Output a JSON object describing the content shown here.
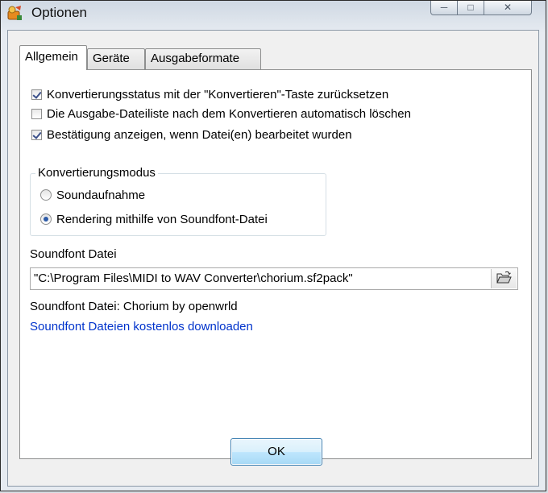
{
  "window": {
    "title": "Optionen",
    "buttons": {
      "minimize": "minimize",
      "maximize": "maximize",
      "close": "close"
    }
  },
  "tabs": [
    {
      "label": "Allgemein",
      "active": true
    },
    {
      "label": "Geräte",
      "active": false
    },
    {
      "label": "Ausgabeformate",
      "active": false
    }
  ],
  "options": [
    {
      "label": "Konvertierungsstatus mit der \"Konvertieren\"-Taste zurücksetzen",
      "checked": true
    },
    {
      "label": "Die Ausgabe-Dateiliste nach dem Konvertieren automatisch löschen",
      "checked": false
    },
    {
      "label": "Bestätigung anzeigen, wenn Datei(en) bearbeitet wurden",
      "checked": true
    }
  ],
  "mode": {
    "label": "Konvertierungsmodus",
    "options": [
      {
        "label": "Soundaufnahme",
        "selected": false
      },
      {
        "label": "Rendering mithilfe von Soundfont-Datei",
        "selected": true
      }
    ]
  },
  "soundfont": {
    "field_label": "Soundfont Datei",
    "path": "\"C:\\Program Files\\MIDI to WAV Converter\\chorium.sf2pack\"",
    "info": "Soundfont Datei: Chorium by openwrld",
    "download_link": "Soundfont Dateien kostenlos downloaden"
  },
  "footer": {
    "ok_label": "OK"
  },
  "icons": {
    "app": "app-icon",
    "browse": "folder-open-icon"
  }
}
